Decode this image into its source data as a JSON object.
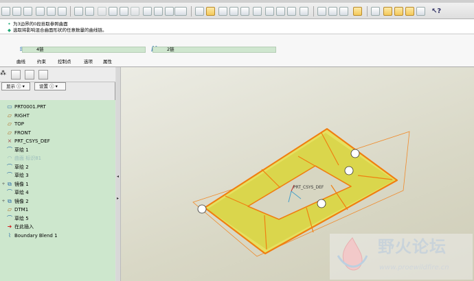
{
  "message": {
    "line1": "为3边界的0段拾取参照曲面",
    "line2": "选取将影响混合曲面形状的任意数量的曲线链。"
  },
  "dashboard": {
    "chain1": "4链",
    "chain2": "2链",
    "tabs": [
      "曲线",
      "约束",
      "控制点",
      "选项",
      "属性"
    ]
  },
  "left_panel": {
    "show_label": "显示",
    "settings_label": "设置"
  },
  "model_tree": [
    {
      "label": "PRT0001.PRT",
      "icon": "part-icon",
      "expand": ""
    },
    {
      "label": "RIGHT",
      "icon": "datum-plane-icon",
      "expand": ""
    },
    {
      "label": "TOP",
      "icon": "datum-plane-icon",
      "expand": ""
    },
    {
      "label": "FRONT",
      "icon": "datum-plane-icon",
      "expand": ""
    },
    {
      "label": "PRT_CSYS_DEF",
      "icon": "csys-icon",
      "expand": ""
    },
    {
      "label": "草绘 1",
      "icon": "sketch-icon",
      "expand": ""
    },
    {
      "label": "曲面 标识81",
      "icon": "surface-icon",
      "expand": "",
      "suppressed": true
    },
    {
      "label": "草绘 2",
      "icon": "sketch-icon",
      "expand": ""
    },
    {
      "label": "草绘 3",
      "icon": "sketch-icon",
      "expand": ""
    },
    {
      "label": "镜像 1",
      "icon": "mirror-icon",
      "expand": "+"
    },
    {
      "label": "草绘 4",
      "icon": "sketch-icon",
      "expand": ""
    },
    {
      "label": "镜像 2",
      "icon": "mirror-icon",
      "expand": "+"
    },
    {
      "label": "DTM1",
      "icon": "datum-plane-icon",
      "expand": ""
    },
    {
      "label": "草绘 5",
      "icon": "sketch-icon",
      "expand": ""
    },
    {
      "label": "在此插入",
      "icon": "insert-here-icon",
      "expand": ""
    },
    {
      "label": "Boundary Blend 1",
      "icon": "boundary-blend-icon",
      "expand": ""
    }
  ],
  "viewport": {
    "csys_label": "PRT_CSYS_DEF"
  },
  "watermark": {
    "title": "野火论坛",
    "url": "www.proewildfire.cn"
  },
  "colors": {
    "tree_bg": "#cde7cd",
    "surface_fill": "#e6e060",
    "edge_orange": "#f07f10"
  }
}
